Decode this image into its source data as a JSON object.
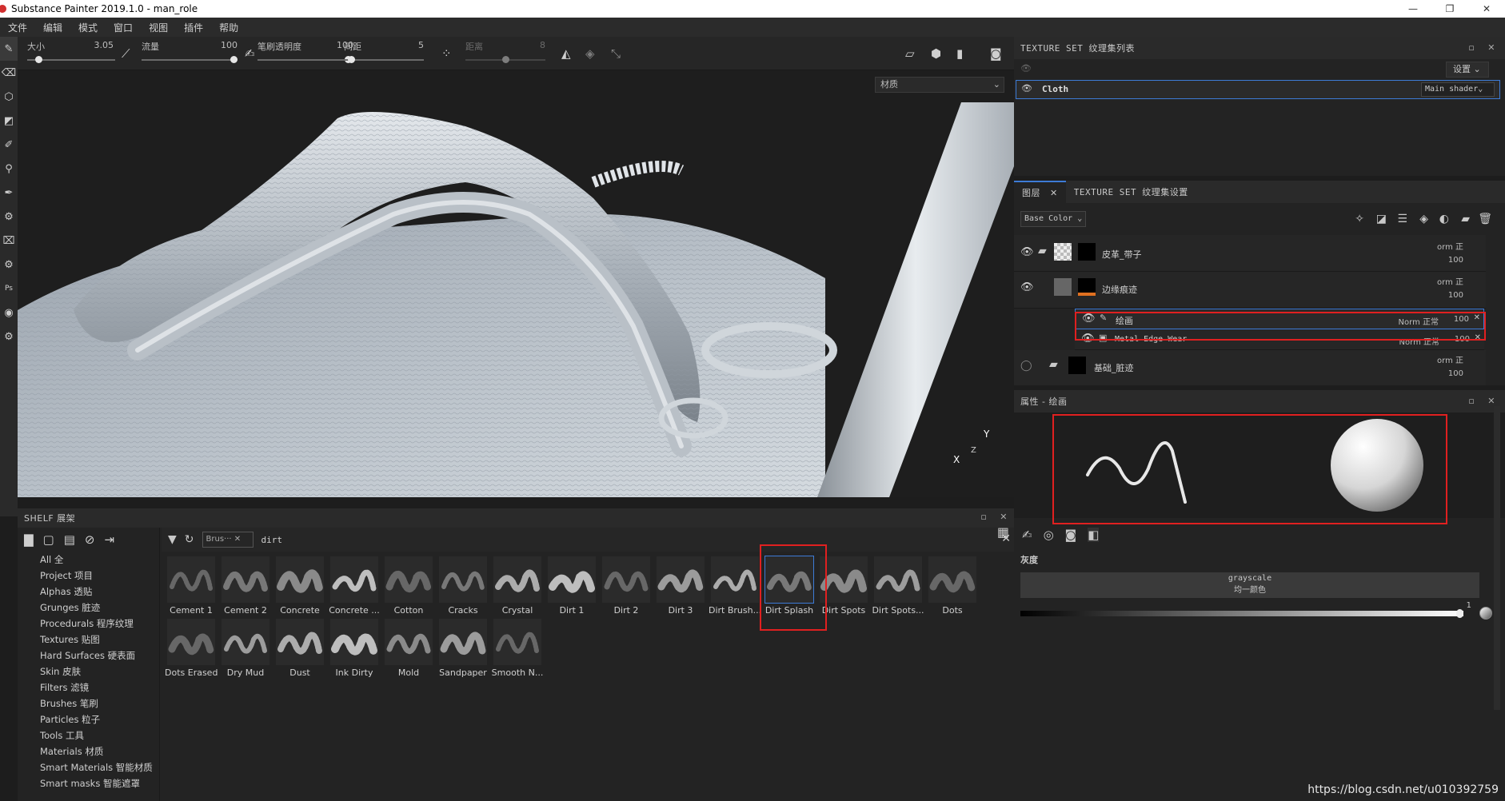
{
  "window": {
    "title": "Substance Painter 2019.1.0 - man_role",
    "minimize": "—",
    "maximize": "❐",
    "close": "✕"
  },
  "menu": [
    "文件",
    "编辑",
    "模式",
    "窗口",
    "视图",
    "插件",
    "帮助"
  ],
  "tool_options": {
    "size_label": "大小",
    "size_value": "3.05",
    "flow_label": "流量",
    "flow_value": "100",
    "stroke_opacity_label": "笔刷透明度",
    "stroke_opacity_value": "100",
    "spacing_label": "间距",
    "spacing_value": "5",
    "distance_label": "距离",
    "distance_value": "8",
    "size_level": 0.1,
    "flow_level": 1.0,
    "opacity_level": 1.0,
    "spacing_level": 0.05,
    "distance_level": 0.5
  },
  "viewport": {
    "material_mode": "材质",
    "axis_y": "Y",
    "axis_z": "Z",
    "axis_x": "X"
  },
  "shelf": {
    "title": "SHELF 展架",
    "filter_chip": "Brus···",
    "search_term": "dirt",
    "categories": [
      "All 全",
      "Project 项目",
      "Alphas 透贴",
      "Grunges 脏迹",
      "Procedurals 程序纹理",
      "Textures 贴图",
      "Hard Surfaces 硬表面",
      "Skin 皮肤",
      "Filters 滤镜",
      "Brushes 笔刷",
      "Particles 粒子",
      "Tools 工具",
      "Materials 材质",
      "Smart Materials 智能材质",
      "Smart masks 智能遮罩"
    ],
    "items_row1": [
      "Cement 1",
      "Cement 2",
      "Concrete",
      "Concrete ...",
      "Cotton",
      "Cracks",
      "Crystal",
      "Dirt 1",
      "Dirt 2",
      "Dirt 3",
      "Dirt Brush...",
      "Dirt Splash",
      "Dirt Spots",
      "Dirt Spots...",
      "Dots"
    ],
    "items_row2": [
      "Dots Erased",
      "Dry Mud",
      "Dust",
      "Ink Dirty",
      "Mold",
      "Sandpaper",
      "Smooth N..."
    ],
    "selected": "Dirt Splash"
  },
  "texture_set_list": {
    "title": "TEXTURE SET 纹理集列表",
    "settings_label": "设置",
    "set_name": "Cloth",
    "shader": "Main shader"
  },
  "layers": {
    "tab_layers": "图层",
    "tab_settings": "TEXTURE SET 纹理集设置",
    "channel": "Base Color",
    "rows": [
      {
        "name": "皮革_带子",
        "blend": "orm 正",
        "opacity": "100"
      },
      {
        "name": "边缘痕迹",
        "blend": "orm 正",
        "opacity": "100"
      },
      {
        "name": "绘画",
        "blend": "Norm 正常",
        "opacity": "100"
      },
      {
        "name": "Metal Edge Wear",
        "blend": "Norm 正常",
        "opacity": "100"
      },
      {
        "name": "基础_脏迹",
        "blend": "orm 正",
        "opacity": "100"
      }
    ]
  },
  "properties": {
    "title": "属性 - 绘画",
    "section": "灰度",
    "mode": "grayscale",
    "mode_sub": "均一颜色",
    "value": "1",
    "gray_level": 1.0
  },
  "watermark": "https://blog.csdn.net/u010392759"
}
